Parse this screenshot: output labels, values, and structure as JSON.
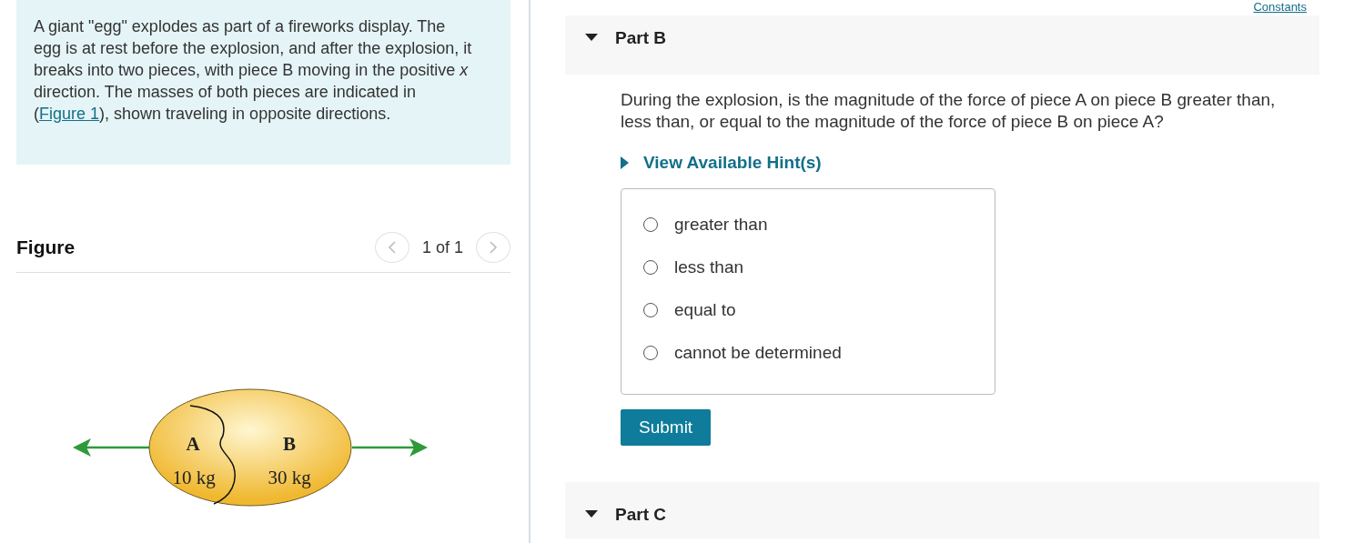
{
  "intro": {
    "text": "A giant \"egg\" explodes as part of a fireworks display. The egg is at rest before the explosion, and after the explosion, it breaks into two pieces, with piece B moving in the positive *x* direction. The masses of both pieces are indicated in (",
    "link": "Figure 1",
    "text_after": "), shown traveling in opposite directions."
  },
  "figure": {
    "title": "Figure",
    "pager": "1 of 1",
    "labels": [
      {
        "letter": "A",
        "mass": "10 kg"
      },
      {
        "letter": "B",
        "mass": "30 kg"
      }
    ]
  },
  "constants_link": "Constants",
  "parts": [
    {
      "title": "Part B",
      "expanded": true,
      "question": "During the explosion, is the magnitude of the force of piece A on piece B greater than, less than, or equal to the magnitude of the force of piece B on piece A?",
      "hint": "View Available Hint(s)",
      "options": [
        {
          "label": "greater than",
          "selected": false
        },
        {
          "label": "less than",
          "selected": false
        },
        {
          "label": "equal to",
          "selected": false
        },
        {
          "label": "cannot be determined",
          "selected": false
        }
      ],
      "submit": "Submit"
    },
    {
      "title": "Part C",
      "expanded": true
    }
  ]
}
